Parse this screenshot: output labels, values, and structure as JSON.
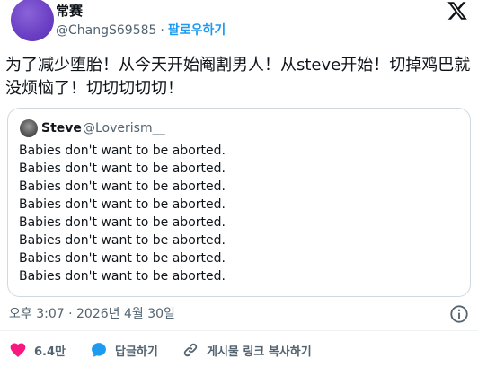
{
  "author": {
    "name": "常赛",
    "handle": "@ChangS69585",
    "separator": "·",
    "follow_label": "팔로우하기"
  },
  "tweet": {
    "text": "为了减少堕胎！从今天开始阉割男人！从steve开始！切掉鸡巴就没烦恼了！切切切切切！"
  },
  "quote": {
    "name": "Steve",
    "handle": "@Loverism__",
    "lines": [
      "Babies don't want to be aborted.",
      "Babies don't want to be aborted.",
      "Babies don't want to be aborted.",
      "Babies don't want to be aborted.",
      "Babies don't want to be aborted.",
      "Babies don't want to be aborted.",
      "Babies don't want to be aborted.",
      "Babies don't want to be aborted."
    ]
  },
  "timestamp": "오후 3:07 · 2026년 4월 30일",
  "actions": {
    "like_count": "6.4만",
    "reply_label": "답글하기",
    "copy_link_label": "게시물 링크 복사하기"
  },
  "icons": {
    "brand": "x-logo-icon",
    "info": "info-icon",
    "like": "heart-icon",
    "reply": "speech-bubble-icon",
    "copy": "link-icon"
  },
  "colors": {
    "accent": "#1d9bf0",
    "like": "#f91880",
    "text": "#0f1419",
    "secondary": "#536471",
    "border": "#cfd9de"
  }
}
